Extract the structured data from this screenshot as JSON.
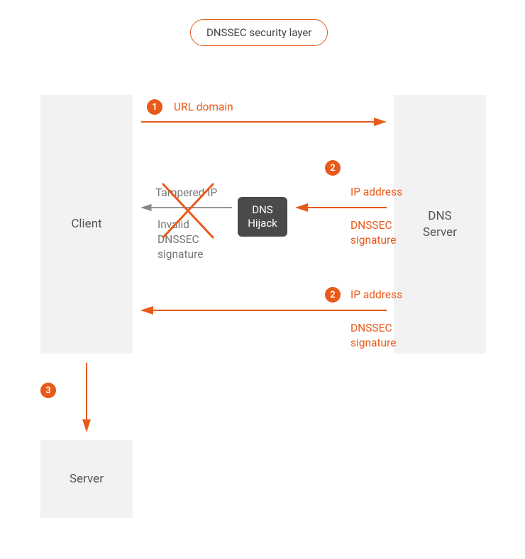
{
  "title": "DNSSEC security layer",
  "nodes": {
    "client": "Client",
    "dns_server": "DNS\nServer",
    "hijack": "DNS\nHijack",
    "server": "Server"
  },
  "steps": {
    "s1": "1",
    "s2a": "2",
    "s2b": "2",
    "s3": "3"
  },
  "labels": {
    "url_domain": "URL domain",
    "tampered_ip": "Tampered IP",
    "invalid_sig": "Invalid\nDNSSEC\nsignature",
    "ip_addr_a": "IP address",
    "sig_a": "DNSSEC\nsignature",
    "ip_addr_b": "IP address",
    "sig_b": "DNSSEC\nsignature"
  },
  "colors": {
    "accent": "#e85a1a",
    "box_bg": "#f2f2f2",
    "hijack_bg": "#4a4a4a",
    "mute": "#777"
  }
}
